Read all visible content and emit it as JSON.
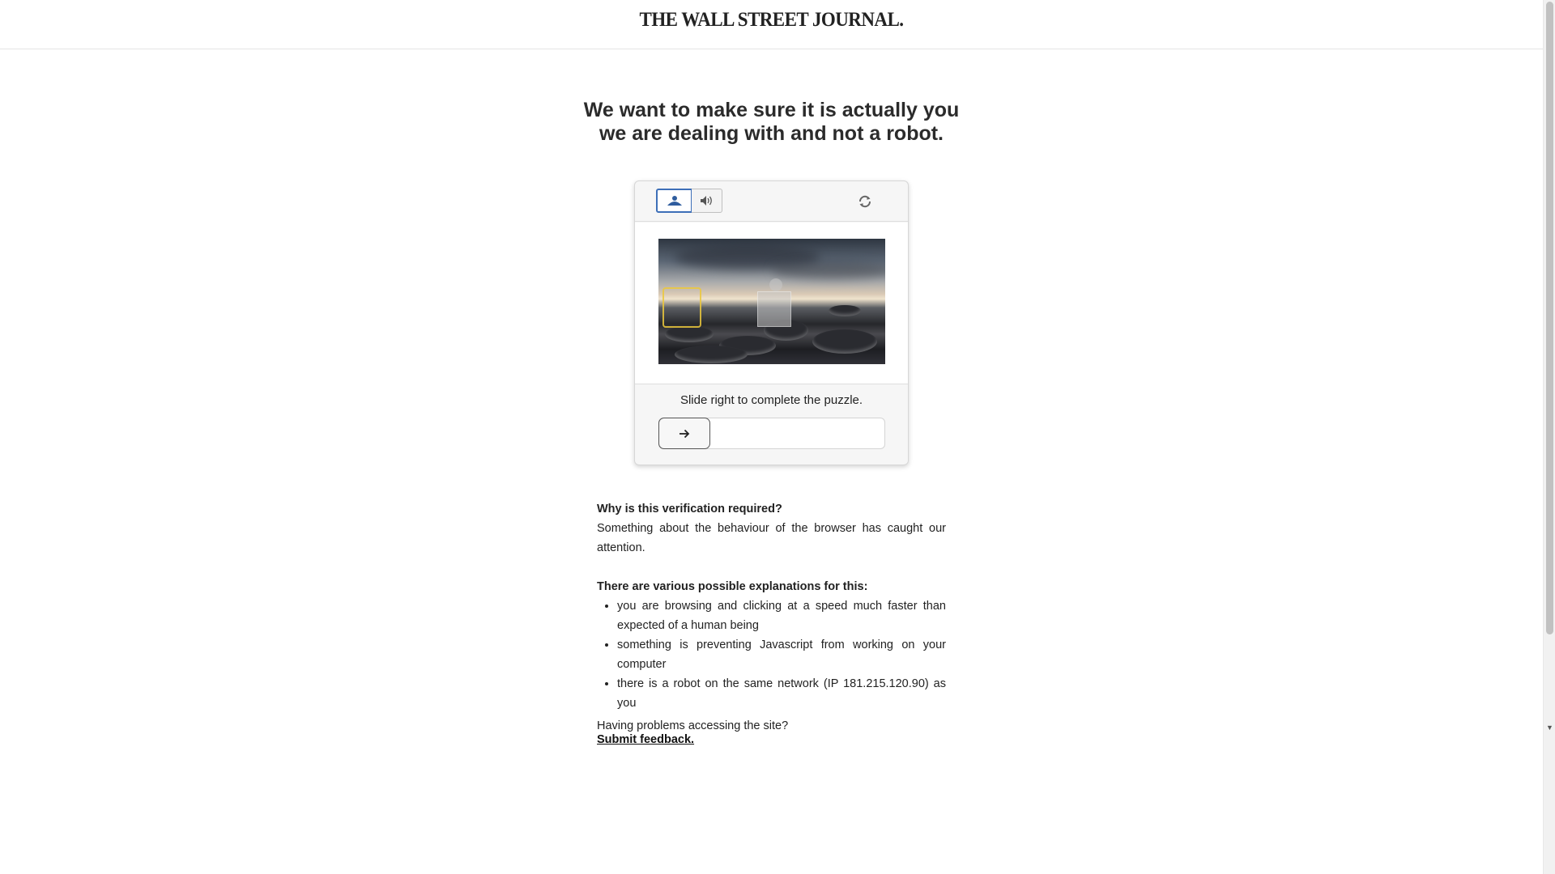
{
  "header": {
    "masthead": "THE WALL STREET JOURNAL."
  },
  "heading": {
    "line1": "We want to make sure it is actually you",
    "line2": "we are dealing with and not a robot."
  },
  "captcha": {
    "modes": [
      {
        "name": "image",
        "icon": "landscape-icon",
        "selected": true
      },
      {
        "name": "audio",
        "icon": "speaker-icon",
        "selected": false
      }
    ],
    "refresh_icon": "refresh-icon",
    "instruction": "Slide right to complete the puzzle.",
    "slider_icon": "arrow-right-icon",
    "slider_progress": 0
  },
  "info": {
    "why_title": "Why is this verification required?",
    "why_text": "Something about the behaviour of the browser has caught our attention.",
    "explanations_title": "There are various possible explanations for this:",
    "explanations": [
      "you are browsing and clicking at a speed much faster than expected of a human being",
      "something is preventing Javascript from working on your computer",
      "there is a robot on the same network (IP 181.215.120.90) as you"
    ],
    "problems_text": "Having problems accessing the site?",
    "feedback_link": "Submit feedback."
  },
  "colors": {
    "selected_border": "#3d6fb8",
    "text": "#222222",
    "puzzle_piece": "#ebc83c"
  }
}
